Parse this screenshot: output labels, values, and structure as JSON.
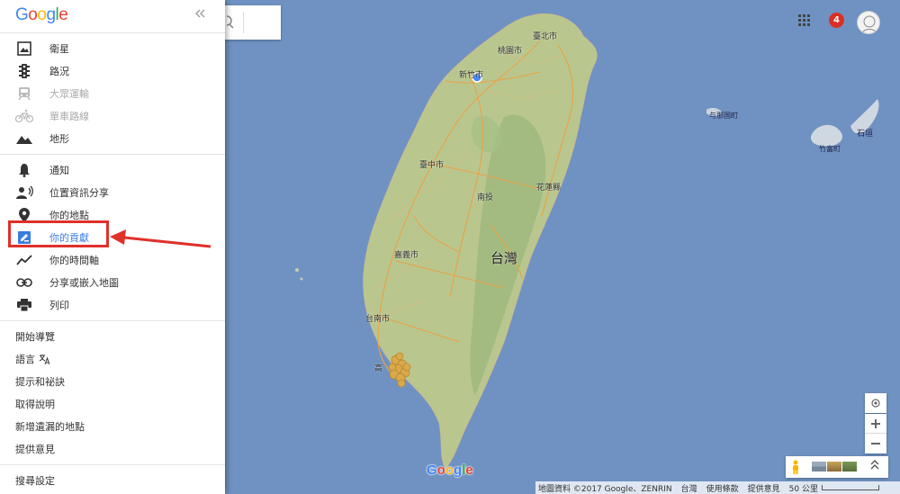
{
  "sidebar": {
    "logo": "Google",
    "collapse_icon": "double-chevron-left-icon",
    "layers": [
      {
        "label": "衛星",
        "icon": "satellite-icon"
      },
      {
        "label": "路況",
        "icon": "traffic-icon"
      },
      {
        "label": "大眾運輸",
        "icon": "transit-icon",
        "disabled": true
      },
      {
        "label": "單車路線",
        "icon": "bicycle-icon",
        "disabled": true
      },
      {
        "label": "地形",
        "icon": "terrain-icon"
      }
    ],
    "personal": [
      {
        "label": "通知",
        "icon": "bell-icon"
      },
      {
        "label": "位置資訊分享",
        "icon": "location-sharing-icon"
      },
      {
        "label": "你的地點",
        "icon": "place-pin-icon"
      },
      {
        "label": "你的貢獻",
        "icon": "contribution-icon",
        "active": true
      },
      {
        "label": "你的時間軸",
        "icon": "timeline-icon"
      },
      {
        "label": "分享或嵌入地圖",
        "icon": "link-icon"
      },
      {
        "label": "列印",
        "icon": "print-icon"
      }
    ],
    "misc": [
      "開始導覽",
      "語言",
      "提示和祕訣",
      "取得說明",
      "新增遺漏的地點",
      "提供意見"
    ],
    "settings": "搜尋設定"
  },
  "header": {
    "notification_count": "4"
  },
  "map": {
    "labels": {
      "taipei": "臺北市",
      "taoyuan": "桃園市",
      "hsinchu": "新竹市",
      "taichung": "臺中市",
      "nantou": "南投",
      "hualien": "花蓮縣",
      "taiwan": "台灣",
      "chiayi": "嘉義市",
      "tainan": "台南市",
      "kaohsiung": "高",
      "yonaguni": "与那国町",
      "taketomi": "竹富町",
      "ishigaki": "石垣"
    },
    "watermark": "Google",
    "colors": {
      "sea": "#6f92c2",
      "land": "#b5c58e",
      "roads": "#e8a44a",
      "highlight": "#e0302a",
      "active": "#3a7de0"
    }
  },
  "attribution": {
    "data": "地圖資料 ©2017 Google、ZENRIN",
    "region": "台灣",
    "terms": "使用條款",
    "feedback": "提供意見",
    "scale": "50 公里"
  }
}
